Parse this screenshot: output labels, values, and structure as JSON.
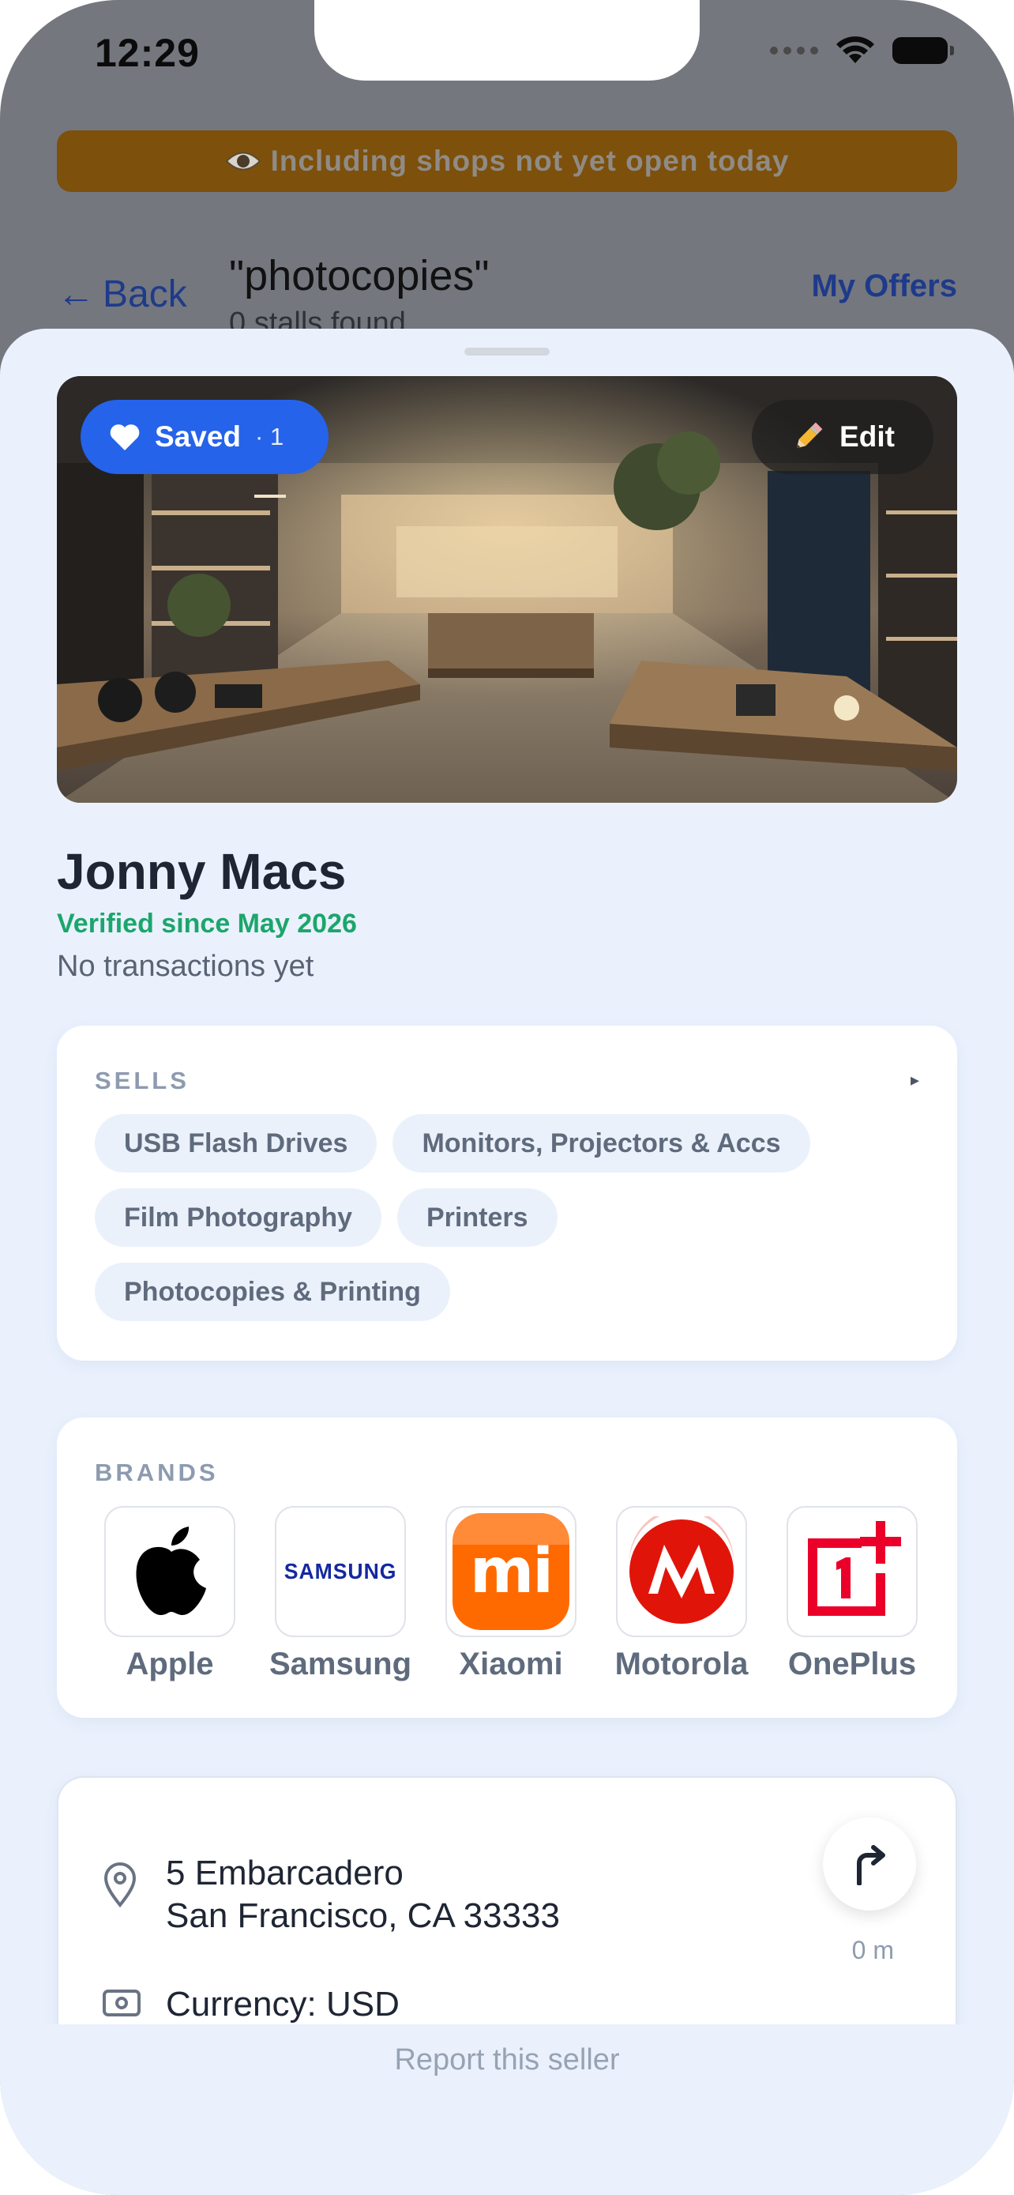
{
  "status_bar": {
    "time": "12:29"
  },
  "banner": {
    "text": "Including shops not yet open today"
  },
  "nav": {
    "back_label": "Back",
    "query": "\"photocopies\"",
    "results": "0 stalls found",
    "my_offers": "My Offers"
  },
  "hero": {
    "saved_label": "Saved",
    "saved_count": "· 1",
    "edit_label": "Edit"
  },
  "shop": {
    "name": "Jonny Macs",
    "verified": "Verified since May 2026",
    "transactions": "No transactions yet"
  },
  "sells": {
    "label": "SELLS",
    "arrow": "▸",
    "categories": [
      "USB Flash Drives",
      "Monitors, Projectors & Accs",
      "Film Photography",
      "Printers",
      "Photocopies & Printing"
    ]
  },
  "brands": {
    "label": "BRANDS",
    "items": [
      {
        "name": "Apple",
        "icon": "apple-logo"
      },
      {
        "name": "Samsung",
        "icon": "samsung-logo",
        "logo_text": "SAMSUNG"
      },
      {
        "name": "Xiaomi",
        "icon": "xiaomi-logo",
        "logo_text": "mi"
      },
      {
        "name": "Motorola",
        "icon": "motorola-logo"
      },
      {
        "name": "OnePlus",
        "icon": "oneplus-logo"
      }
    ]
  },
  "location": {
    "address_line1": "5 Embarcadero",
    "address_line2": "San Francisco, CA 33333",
    "distance": "0 m",
    "currency": "Currency: USD"
  },
  "footer": {
    "report": "Report this seller"
  },
  "colors": {
    "accent": "#2563eb",
    "verified": "#1ba66b",
    "banner": "#7d500b",
    "sheet": "#eaf1fd"
  }
}
